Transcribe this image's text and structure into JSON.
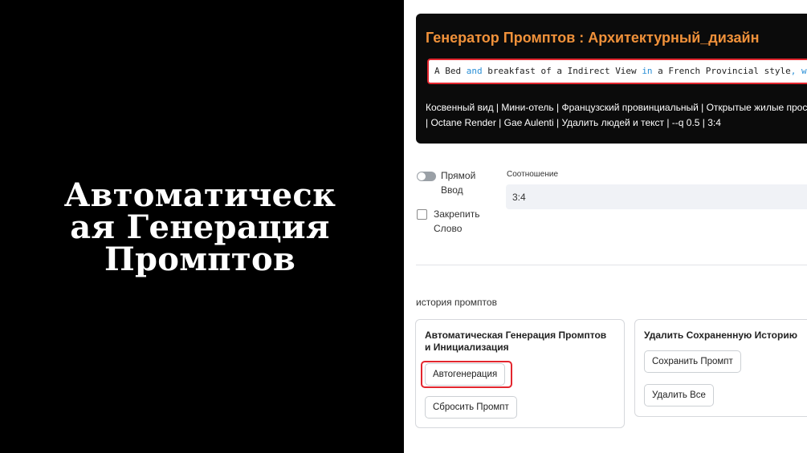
{
  "slide": {
    "title": "Автоматическая Генерация Промптов"
  },
  "generator": {
    "title": "Генератор Промптов : Архитектурный_дизайн",
    "prompt_tokens": [
      {
        "text": "A Bed ",
        "kw": false
      },
      {
        "text": "and",
        "kw": true
      },
      {
        "text": " breakfast of a Indirect View ",
        "kw": false
      },
      {
        "text": "in",
        "kw": true
      },
      {
        "text": " a French Provincial style",
        "kw": false
      },
      {
        "text": ", with",
        "kw": true
      }
    ],
    "tags_line1": "Косвенный вид | Мини-отель | Французский провинциальный | Открытые жилые простра",
    "tags_line2": "| Octane Render | Gae Aulenti | Удалить людей и текст | --q 0.5 | 3:4"
  },
  "options": {
    "direct_input_label": "Прямой Ввод",
    "direct_input_on": false,
    "pin_word_label": "Закрепить Слово",
    "pin_word_checked": false
  },
  "ratio": {
    "label": "Соотношение",
    "value": "3:4"
  },
  "history": {
    "label": "история промптов"
  },
  "auto_card": {
    "title": "Автоматическая Генерация Промптов и Инициализация",
    "generate_button": "Автогенерация",
    "reset_button": "Сбросить Промпт"
  },
  "delete_card": {
    "title": "Удалить Сохраненную Историю",
    "save_button": "Сохранить Промпт",
    "delete_all_button": "Удалить Все"
  },
  "colors": {
    "accent_orange": "#f0913a",
    "highlight_red": "#e3262e",
    "keyword_blue": "#2a8fd6"
  }
}
